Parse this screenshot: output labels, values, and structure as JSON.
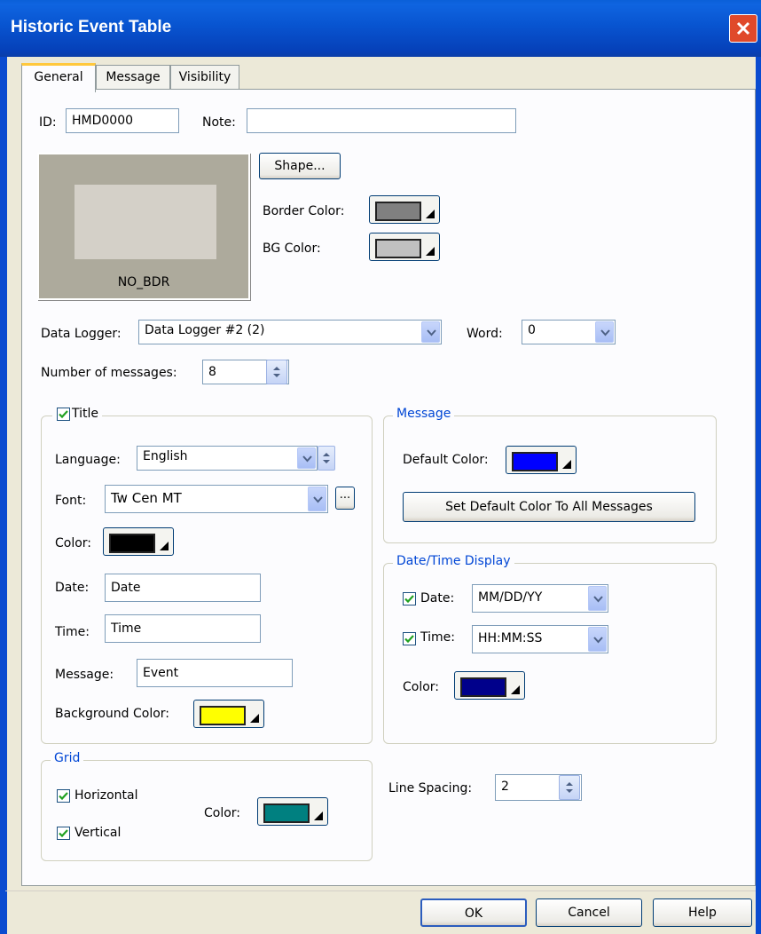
{
  "window": {
    "title": "Historic Event Table"
  },
  "tabs": [
    {
      "label": "General",
      "active": true
    },
    {
      "label": "Message",
      "active": false
    },
    {
      "label": "Visibility",
      "active": false
    }
  ],
  "general": {
    "id_label": "ID:",
    "id_value": "HMD0000",
    "note_label": "Note:",
    "note_value": "",
    "preview_name": "NO_BDR",
    "shape_button": "Shape...",
    "border_color_label": "Border Color:",
    "border_color": "#808080",
    "bg_color_label": "BG Color:",
    "bg_color": "#c0c0c0",
    "data_logger_label": "Data Logger:",
    "data_logger_value": "Data Logger #2 (2)",
    "word_label": "Word:",
    "word_value": "0",
    "num_messages_label": "Number of messages:",
    "num_messages_value": "8"
  },
  "title_group": {
    "legend": "Title",
    "checked": true,
    "language_label": "Language:",
    "language_value": "English",
    "font_label": "Font:",
    "font_value": "Tw Cen MT",
    "font_browse": "...",
    "color_label": "Color:",
    "color": "#000000",
    "date_label": "Date:",
    "date_value": "Date",
    "time_label": "Time:",
    "time_value": "Time",
    "message_label": "Message:",
    "message_value": "Event",
    "bg_color_label": "Background Color:",
    "bg_color": "#ffff00"
  },
  "message_group": {
    "legend": "Message",
    "default_color_label": "Default Color:",
    "default_color": "#0000ff",
    "set_default_button": "Set Default Color To All Messages"
  },
  "datetime_group": {
    "legend": "Date/Time Display",
    "date_label": "Date:",
    "date_checked": true,
    "date_format": "MM/DD/YY",
    "time_label": "Time:",
    "time_checked": true,
    "time_format": "HH:MM:SS",
    "color_label": "Color:",
    "color": "#00008b"
  },
  "grid_group": {
    "legend": "Grid",
    "horizontal_label": "Horizontal",
    "horizontal_checked": true,
    "vertical_label": "Vertical",
    "vertical_checked": true,
    "color_label": "Color:",
    "color": "#008080"
  },
  "line_spacing": {
    "label": "Line Spacing:",
    "value": "2"
  },
  "buttons": {
    "ok": "OK",
    "cancel": "Cancel",
    "help": "Help"
  },
  "icons": {
    "close": "close-icon",
    "dropdown": "chevron-down-icon",
    "spinner": "spinner-arrows-icon",
    "checkmark": "checkmark-icon",
    "color_arrow": "triangle-icon"
  }
}
